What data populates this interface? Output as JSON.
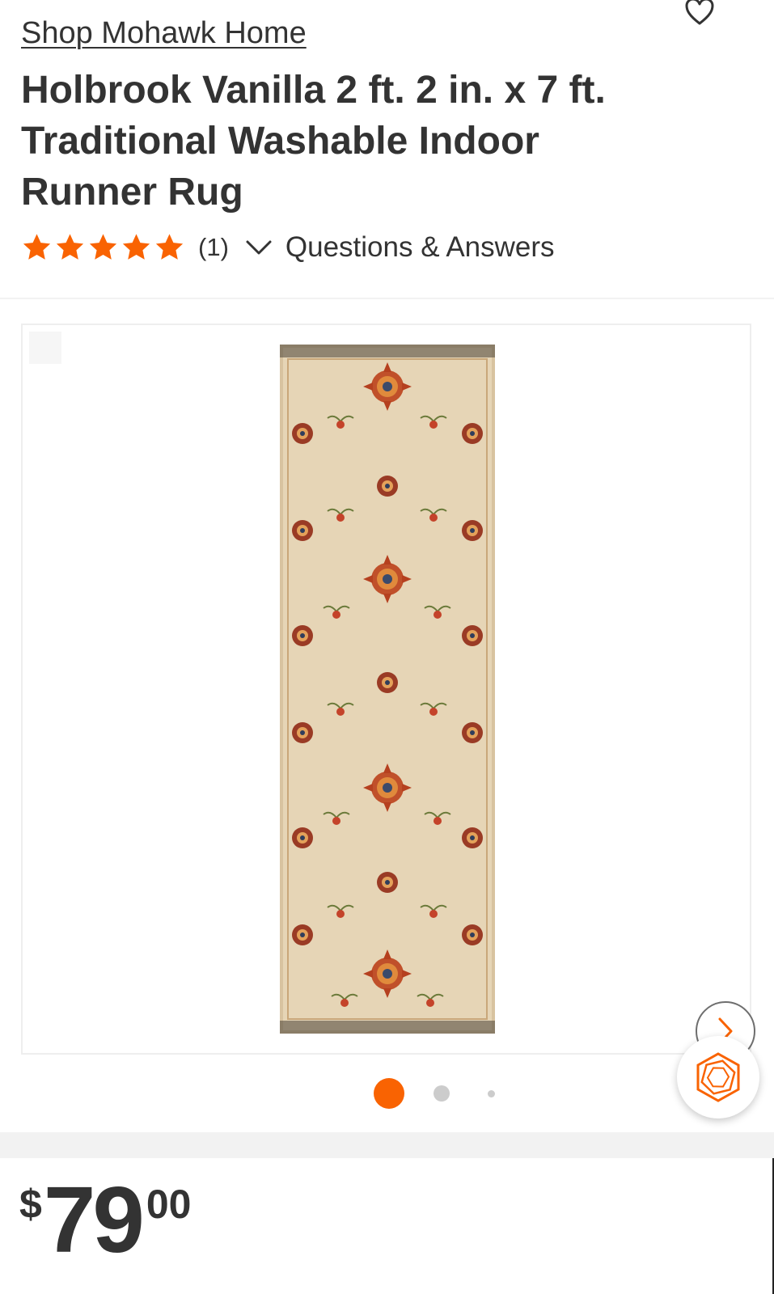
{
  "brand_link": "Shop Mohawk Home",
  "product": {
    "title": "Holbrook Vanilla 2 ft. 2 in. x 7 ft. Traditional Washable Indoor Runner Rug",
    "rating": 5,
    "review_count": "(1)",
    "qa_label": "Questions & Answers"
  },
  "gallery": {
    "image_count": 3,
    "active_index": 0
  },
  "price": {
    "currency_symbol": "$",
    "dollars": "79",
    "cents": "00"
  },
  "colors": {
    "accent": "#f96302",
    "text": "#333333",
    "dot_inactive": "#cccccc"
  },
  "icons": {
    "favorite": "heart-outline-icon",
    "star": "star-icon",
    "expand": "chevron-down-icon",
    "next": "chevron-right-icon",
    "assistant": "hexagon-logo-icon"
  }
}
